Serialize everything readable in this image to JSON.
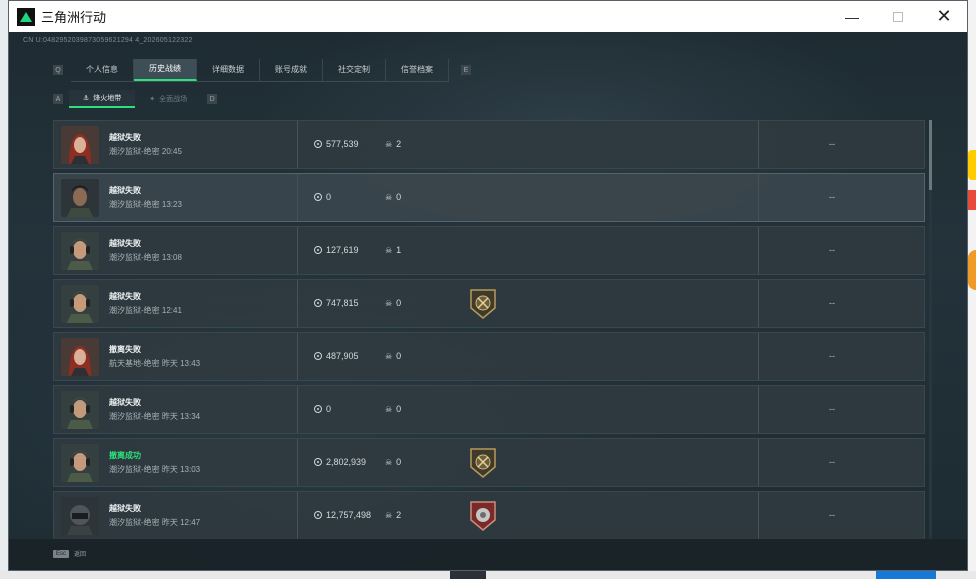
{
  "window": {
    "title": "三角洲行动"
  },
  "uid": "CN U:0482952039873059621294 4_202605122322",
  "tabs": [
    {
      "label": "个人信息",
      "active": false
    },
    {
      "label": "历史战绩",
      "active": true
    },
    {
      "label": "详细数据",
      "active": false
    },
    {
      "label": "账号成就",
      "active": false
    },
    {
      "label": "社交定制",
      "active": false
    },
    {
      "label": "信誉档案",
      "active": false
    }
  ],
  "tab_nav": {
    "left": "Q",
    "right": "E"
  },
  "subtabs": [
    {
      "label": "烽火地带",
      "active": true
    },
    {
      "label": "全面战场",
      "active": false
    }
  ],
  "subtab_nav": {
    "left": "A",
    "right": "D"
  },
  "rows": [
    {
      "avatar": "operator-red-hair",
      "result": "越狱失败",
      "success": false,
      "map": "潮汐监狱-绝密 20:45",
      "value": "577,539",
      "kills": "2",
      "badge": "",
      "extra": "--"
    },
    {
      "avatar": "operator-dark",
      "result": "越狱失败",
      "success": false,
      "map": "潮汐监狱-绝密 13:23",
      "value": "0",
      "kills": "0",
      "badge": "",
      "extra": "--"
    },
    {
      "avatar": "operator-headset",
      "result": "越狱失败",
      "success": false,
      "map": "潮汐监狱-绝密 13:08",
      "value": "127,619",
      "kills": "1",
      "badge": "",
      "extra": "--"
    },
    {
      "avatar": "operator-headset",
      "result": "越狱失败",
      "success": false,
      "map": "潮汐监狱-绝密 12:41",
      "value": "747,815",
      "kills": "0",
      "badge": "gold-shield",
      "extra": "--"
    },
    {
      "avatar": "operator-red-hair",
      "result": "撤离失败",
      "success": false,
      "map": "航天基地-绝密 昨天 13:43",
      "value": "487,905",
      "kills": "0",
      "badge": "",
      "extra": "--"
    },
    {
      "avatar": "operator-headset",
      "result": "越狱失败",
      "success": false,
      "map": "潮汐监狱-绝密 昨天 13:34",
      "value": "0",
      "kills": "0",
      "badge": "",
      "extra": "--"
    },
    {
      "avatar": "operator-headset",
      "result": "撤离成功",
      "success": true,
      "map": "潮汐监狱-绝密 昨天 13:03",
      "value": "2,802,939",
      "kills": "0",
      "badge": "gold-shield",
      "extra": "--"
    },
    {
      "avatar": "operator-helmet",
      "result": "越狱失败",
      "success": false,
      "map": "潮汐监狱-绝密 昨天 12:47",
      "value": "12,757,498",
      "kills": "2",
      "badge": "red-shield",
      "extra": "--"
    }
  ],
  "footer": {
    "key": "Esc",
    "label": "返回"
  },
  "colors": {
    "accent": "#2ee07b",
    "bg": "#1e2b32"
  }
}
